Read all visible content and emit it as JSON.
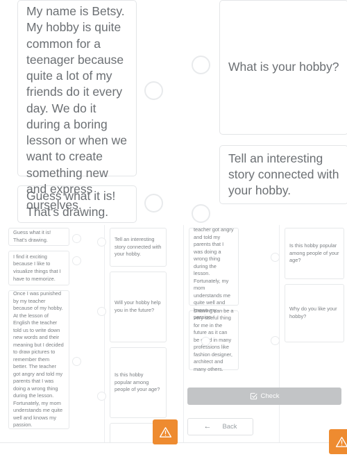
{
  "exercise": {
    "zoomed_view": {
      "left_column": [
        {
          "id": "answer-betsy",
          "text": "My name is Betsy. My hobby is quite common for a teenager because quite a lot of my friends do it every day. We do it during a boring lesson or when we want to create something new and express ourselves."
        },
        {
          "id": "answer-guess",
          "text": "Guess what it is! That's drawing."
        }
      ],
      "right_column": [
        {
          "id": "question-what-hobby",
          "text": "What is your hobby?"
        },
        {
          "id": "question-tell-story",
          "text": "Tell an interesting story connected with your hobby."
        }
      ],
      "connectors": [
        {
          "id": "connector-left-1"
        },
        {
          "id": "connector-left-2"
        },
        {
          "id": "connector-right-1"
        },
        {
          "id": "connector-right-2"
        }
      ]
    },
    "mini_view": {
      "column_1": [
        {
          "id": "mini-answer-guess",
          "text": "Guess what it is! That's drawing."
        },
        {
          "id": "mini-answer-exciting",
          "text": "I find it exciting because I like to visualize things that I have to memorize."
        },
        {
          "id": "mini-answer-punished",
          "text": "Once I was punished by my teacher because of my hobby. At the lesson of English the teacher told us to write down new words and their meaning but I decided to draw pictures to remember them better. The teacher got angry and told my parents that I was doing a wrong thing during the lesson. Fortunately, my mom understands me quite well and knows my passion."
        }
      ],
      "column_2": [
        {
          "id": "mini-question-tell-story",
          "text": "Tell an interesting story connected with your hobby."
        },
        {
          "id": "mini-question-future",
          "text": "Will your hobby help you in the future?"
        },
        {
          "id": "mini-question-popular",
          "text": "Is this hobby popular among people of your age?"
        }
      ],
      "column_3": [
        {
          "id": "mini-answer-punished-cont",
          "text": "remember them better. The teacher got angry and told my parents that I was doing a wrong thing during the lesson. Fortunately, my mom understands me quite well and knows my passion."
        },
        {
          "id": "mini-answer-drawing-useful",
          "text": "Drawing can be a very useful thing for me in the future as it can be used in many professions like fashion designer, architect and many others."
        }
      ],
      "column_4": [
        {
          "id": "mini-question-popular-2",
          "text": "Is this hobby popular among people of your age?"
        },
        {
          "id": "mini-question-why-like",
          "text": "Why do you like your hobby?"
        }
      ],
      "buttons": {
        "check_label": "Check",
        "back_label": "Back",
        "check_icon": "check-square-icon",
        "back_icon": "arrow-left-icon"
      },
      "warnings": [
        {
          "id": "warning-badge-1",
          "icon": "warning-triangle-icon"
        },
        {
          "id": "warning-badge-2",
          "icon": "warning-triangle-icon"
        }
      ]
    }
  },
  "colors": {
    "accent_warning": "#ee8b30",
    "check_button": "#c2c4c6",
    "card_border": "#e3e5e7",
    "text": "#6e7276"
  }
}
